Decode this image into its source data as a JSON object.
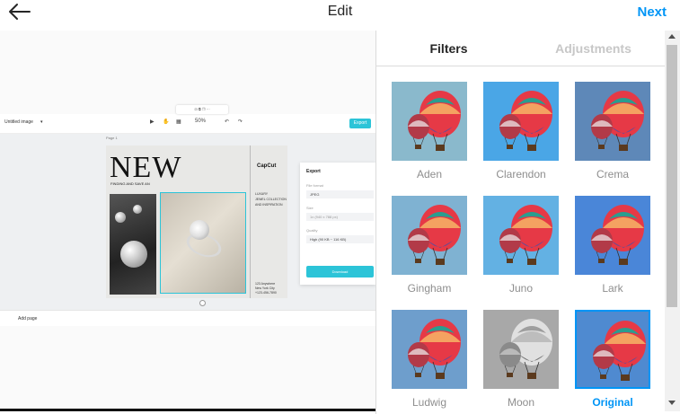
{
  "header": {
    "title": "Edit",
    "next_label": "Next",
    "back_icon": "arrow-left-icon"
  },
  "tabs": [
    {
      "label": "Filters",
      "active": true
    },
    {
      "label": "Adjustments",
      "active": false
    }
  ],
  "filters": [
    {
      "name": "Aden",
      "tint": "#8ab9cc",
      "selected": false
    },
    {
      "name": "Clarendon",
      "tint": "#4aa6e6",
      "selected": false
    },
    {
      "name": "Crema",
      "tint": "#5e88b8",
      "selected": false
    },
    {
      "name": "Gingham",
      "tint": "#7fb2d2",
      "selected": false
    },
    {
      "name": "Juno",
      "tint": "#63b1e3",
      "selected": false
    },
    {
      "name": "Lark",
      "tint": "#4a86d8",
      "selected": false
    },
    {
      "name": "Ludwig",
      "tint": "#6e9ecc",
      "selected": false
    },
    {
      "name": "Moon",
      "tint": "#a8a8a8",
      "selected": false,
      "grayscale": true
    },
    {
      "name": "Original",
      "tint": "#4f8ad0",
      "selected": true
    }
  ],
  "preview": {
    "editor": {
      "doc_label": "Untitled image",
      "zoom": "50%",
      "export_button": "Export",
      "page_label": "Page 1",
      "headline": "NEW",
      "subline": "FINDING AND SAVE AN",
      "brand": "CapCut",
      "side_lines": [
        "LUXURY",
        "JEWEL COLLECTION",
        "AND INSPIRATION"
      ],
      "footer_lines": [
        "123 Anywhere",
        "New York City",
        "+123-456-7890"
      ],
      "export_panel": {
        "title": "Export",
        "file_format_label": "File format",
        "file_format_value": "JPEG",
        "size_label": "Size",
        "size_value": "1x  (940 x 788 px)",
        "quality_label": "Quality",
        "quality_value": "High (90 KB ~ 116 KB)",
        "download_label": "Download"
      },
      "add_page_label": "Add page"
    }
  },
  "colors": {
    "accent": "#0095f6",
    "editor_accent": "#2cc4d8"
  }
}
